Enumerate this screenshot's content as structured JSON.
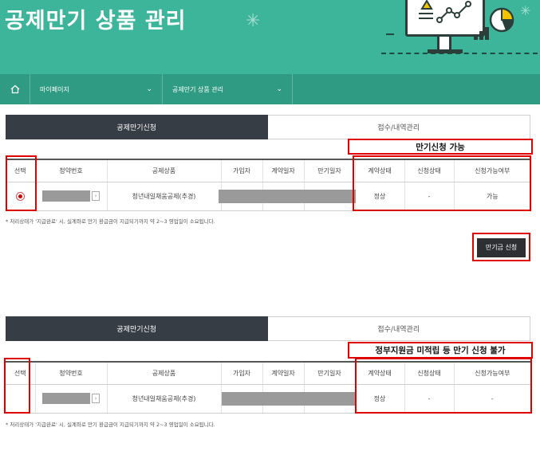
{
  "hero": {
    "title": "공제만기 상품 관리",
    "bg_color": "#3db59a"
  },
  "nav": {
    "home_icon": "home-icon",
    "items": [
      {
        "label": "마이페이지"
      },
      {
        "label": "공제만기 상품 관리"
      }
    ],
    "bg_color": "#2f9b82"
  },
  "tabs": {
    "apply": "공제만기신청",
    "history": "접수/내역관리"
  },
  "columns": [
    "선택",
    "청약번호",
    "공제상품",
    "가입자",
    "계약일자",
    "만기일자",
    "계약상태",
    "신청상태",
    "신청가능여부"
  ],
  "panel1": {
    "callout": "만기신청 가능",
    "row": {
      "product": "청년내일채움공제(추경)",
      "contract_status": "정상",
      "apply_status": "-",
      "available": "가능"
    },
    "selected": true
  },
  "panel2": {
    "callout": "정부지원금 미적립 등 만기 신청 불가",
    "row": {
      "product": "청년내일채움공제(추경)",
      "contract_status": "정상",
      "apply_status": "-",
      "available": "-"
    }
  },
  "footnote": "* 처리상태가 '지급완료' 시, 실계좌로 만기 환급금이 지급되기까지 약 2~3 영업일이 소요됩니다.",
  "apply_button": "만기금 신청",
  "accent_color": "#e10000"
}
